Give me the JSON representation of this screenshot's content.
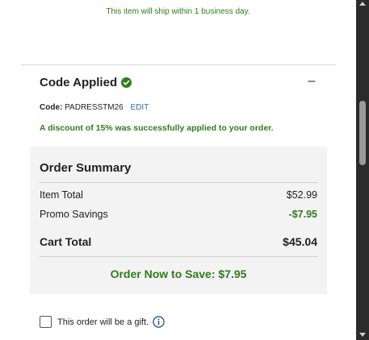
{
  "shipping": {
    "note": "This item will ship within 1 business day."
  },
  "promo": {
    "title": "Code Applied",
    "collapse_label": "–",
    "code_label": "Code:",
    "code_value": "PADRESSTM26",
    "edit_label": "EDIT",
    "success_message": "A discount of 15% was successfully applied to your order."
  },
  "summary": {
    "title": "Order Summary",
    "item_total_label": "Item Total",
    "item_total_value": "$52.99",
    "promo_label": "Promo Savings",
    "promo_value": "-$7.95",
    "cart_total_label": "Cart Total",
    "cart_total_value": "$45.04",
    "save_message": "Order Now to Save: $7.95"
  },
  "gift": {
    "label": "This order will be a gift."
  },
  "colors": {
    "success_green": "#2e7d1b",
    "link_blue": "#2a6fb0",
    "summary_bg": "#f3f3f3"
  },
  "icons": {
    "check": "check-circle-icon",
    "info": "info-circle-icon"
  }
}
